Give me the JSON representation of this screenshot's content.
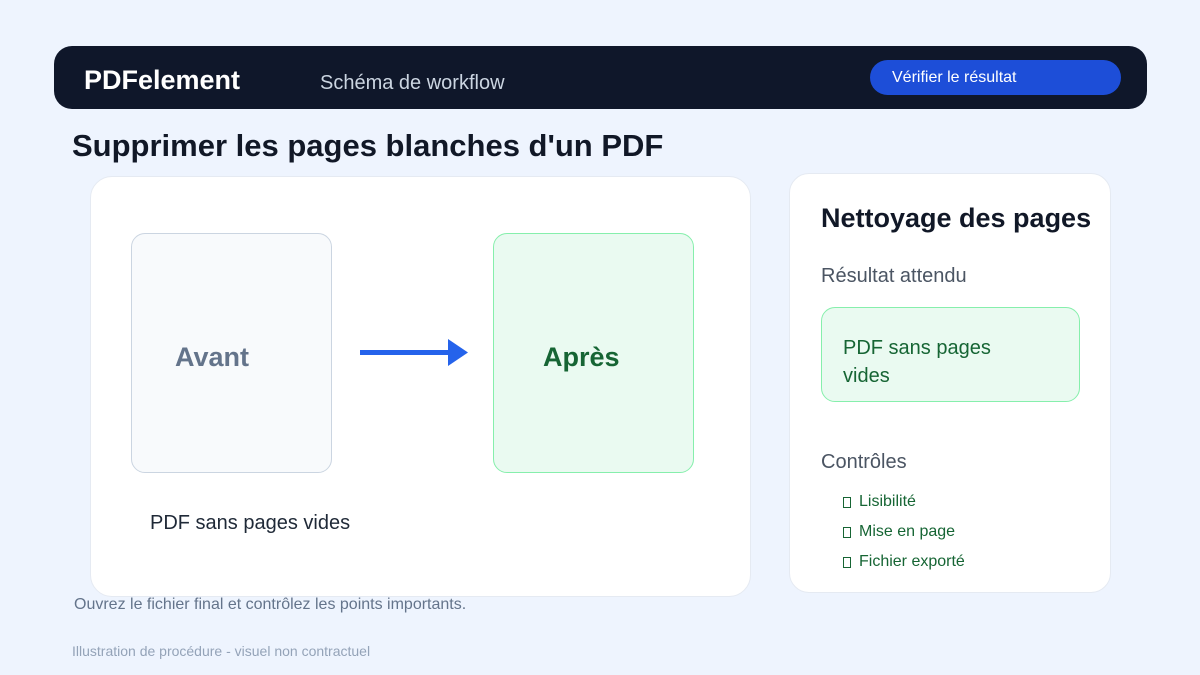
{
  "header": {
    "brand": "PDFelement",
    "subtitle": "Schéma de workflow",
    "verify_button": "Vérifier le résultat"
  },
  "page_title": "Supprimer les pages blanches d'un PDF",
  "diagram": {
    "before_label": "Avant",
    "after_label": "Après",
    "caption": "PDF sans pages vides",
    "arrow_icon": "arrow-right-icon"
  },
  "side_panel": {
    "title": "Nettoyage des pages",
    "result_label": "Résultat attendu",
    "result_value": "PDF sans pages vides",
    "checks_label": "Contrôles",
    "checks": [
      "Lisibilité",
      "Mise en page",
      "Fichier exporté"
    ]
  },
  "footnote": "Ouvrez le fichier final et contrôlez les points importants.",
  "footer": "Illustration de procédure - visuel non contractuel",
  "colors": {
    "accent": "#1d4ed8",
    "arrow": "#2563eb",
    "success": "#166534",
    "topbar": "#0f172a"
  }
}
